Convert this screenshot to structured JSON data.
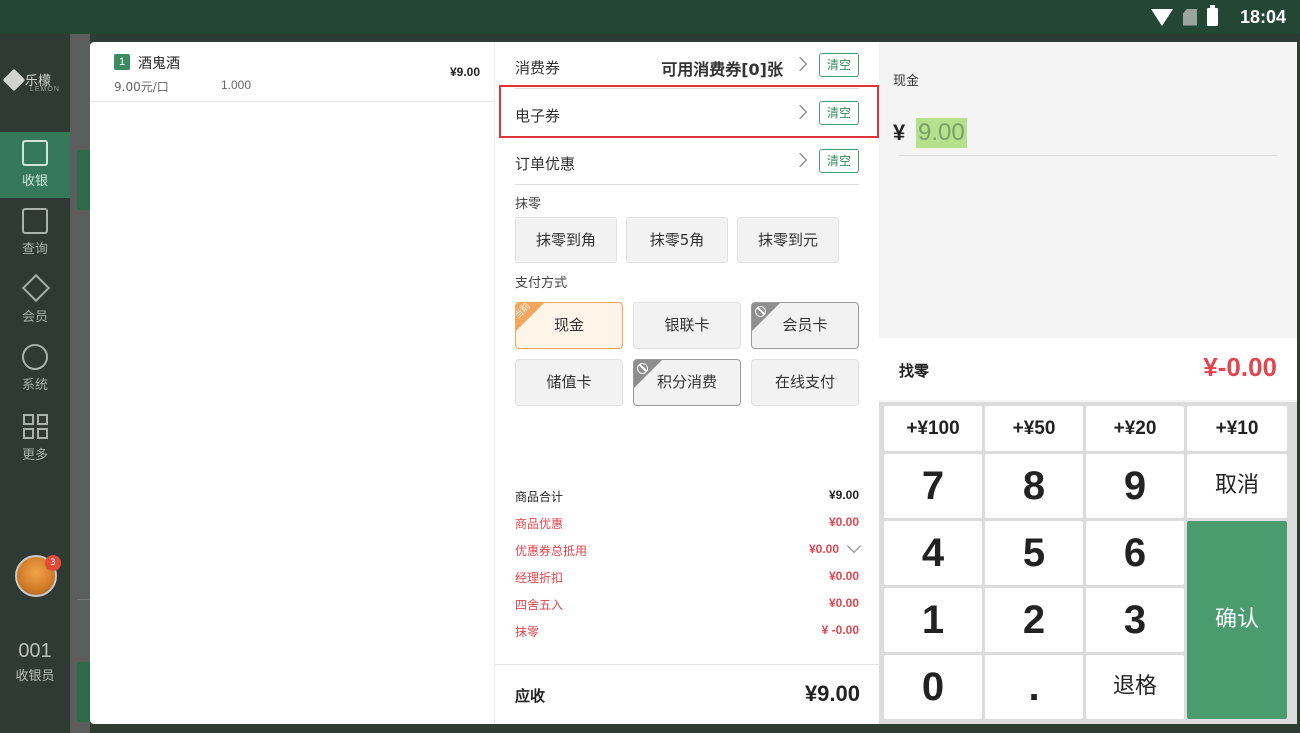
{
  "status_bar": {
    "time": "18:04"
  },
  "sidebar": {
    "logo": "乐檬",
    "logo_sub": "LEMON",
    "items": [
      {
        "label": "收银",
        "icon": "cashier-icon"
      },
      {
        "label": "查询",
        "icon": "search-doc-icon"
      },
      {
        "label": "会员",
        "icon": "diamond-icon"
      },
      {
        "label": "系统",
        "icon": "gear-icon"
      },
      {
        "label": "更多",
        "icon": "grid-icon"
      }
    ],
    "notification_count": "3",
    "cashier_no": "001",
    "cashier_label": "收银员"
  },
  "order": {
    "items": [
      {
        "index": "1",
        "name": "酒鬼酒",
        "unit_price": "9.00元/口",
        "qty": "1.000",
        "amount": "¥9.00"
      }
    ]
  },
  "discounts": {
    "coupon": {
      "label": "消费券",
      "value": "可用消费券[0]张",
      "clear": "清空"
    },
    "ecoupon": {
      "label": "电子券",
      "clear": "清空"
    },
    "order_discount": {
      "label": "订单优惠",
      "clear": "清空"
    },
    "rounding_label": "抹零",
    "rounding_options": [
      "抹零到角",
      "抹零5角",
      "抹零到元"
    ],
    "payment_label": "支付方式",
    "payment_methods": [
      {
        "label": "现金",
        "state": "current",
        "tag": "当前"
      },
      {
        "label": "银联卡",
        "state": "normal"
      },
      {
        "label": "会员卡",
        "state": "disabled"
      },
      {
        "label": "储值卡",
        "state": "normal"
      },
      {
        "label": "积分消费",
        "state": "disabled"
      },
      {
        "label": "在线支付",
        "state": "normal"
      }
    ]
  },
  "summary": {
    "goods_total": {
      "label": "商品合计",
      "value": "¥9.00"
    },
    "goods_discount": {
      "label": "商品优惠",
      "value": "¥0.00"
    },
    "coupon_total": {
      "label": "优惠券总抵用",
      "value": "¥0.00"
    },
    "manager_discount": {
      "label": "经理折扣",
      "value": "¥0.00"
    },
    "rounding": {
      "label": "四舍五入",
      "value": "¥0.00"
    },
    "wipe": {
      "label": "抹零",
      "value": "¥ -0.00"
    },
    "due": {
      "label": "应收",
      "value": "¥9.00"
    }
  },
  "payment": {
    "cash_label": "现金",
    "currency": "¥",
    "cash_amount": "9.00",
    "change_label": "找零",
    "change_value": "¥-0.00"
  },
  "keypad": {
    "quick": [
      "+¥100",
      "+¥50",
      "+¥20",
      "+¥10"
    ],
    "digits": [
      "7",
      "8",
      "9",
      "4",
      "5",
      "6",
      "1",
      "2",
      "3",
      "0",
      "."
    ],
    "cancel": "取消",
    "confirm": "确认",
    "backspace": "退格"
  },
  "colors": {
    "brand_green": "#4a9c6f",
    "alert_red": "#e2454d",
    "highlight_box": "#e0333a",
    "current_tag": "#f3a65c"
  }
}
